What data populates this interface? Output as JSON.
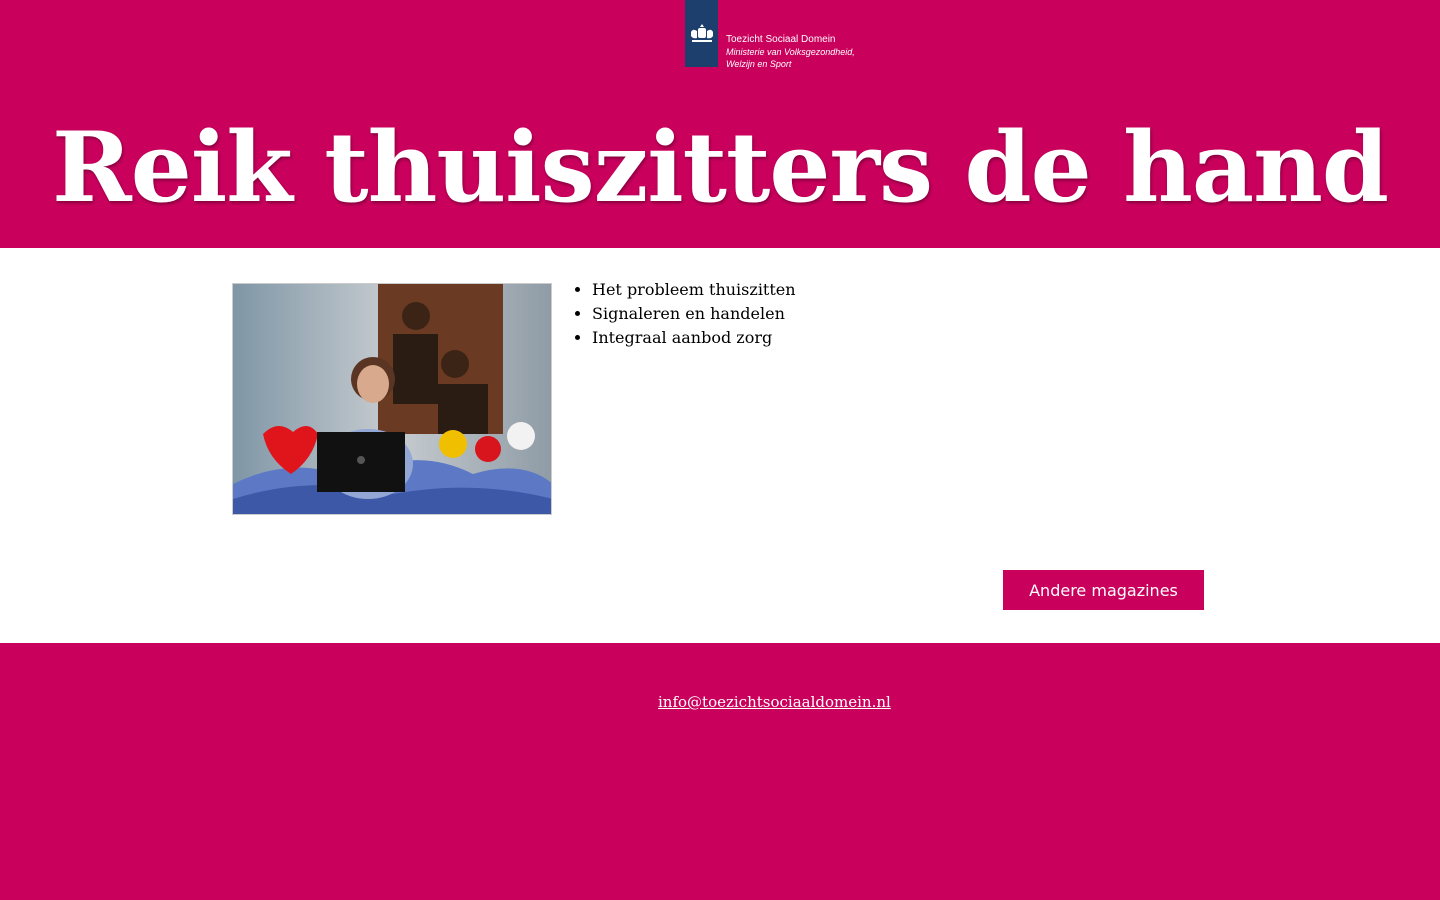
{
  "header": {
    "logo": {
      "org_name": "Toezicht Sociaal Domein",
      "ministry_line1": "Ministerie van Volksgezondheid,",
      "ministry_line2": "Welzijn en Sport",
      "icon": "crest-icon"
    },
    "title": "Reik thuiszitters de hand"
  },
  "main": {
    "photo_icon": "photo-girl-laptop",
    "topics": [
      "Het probleem thuiszitten",
      "Signaleren en handelen",
      "Integraal aanbod zorg"
    ],
    "cta_label": "Andere magazines"
  },
  "footer": {
    "email": "info@toezichtsociaaldomein.nl"
  },
  "colors": {
    "brand": "#ca005d",
    "logo_blue": "#1c3f6d"
  }
}
